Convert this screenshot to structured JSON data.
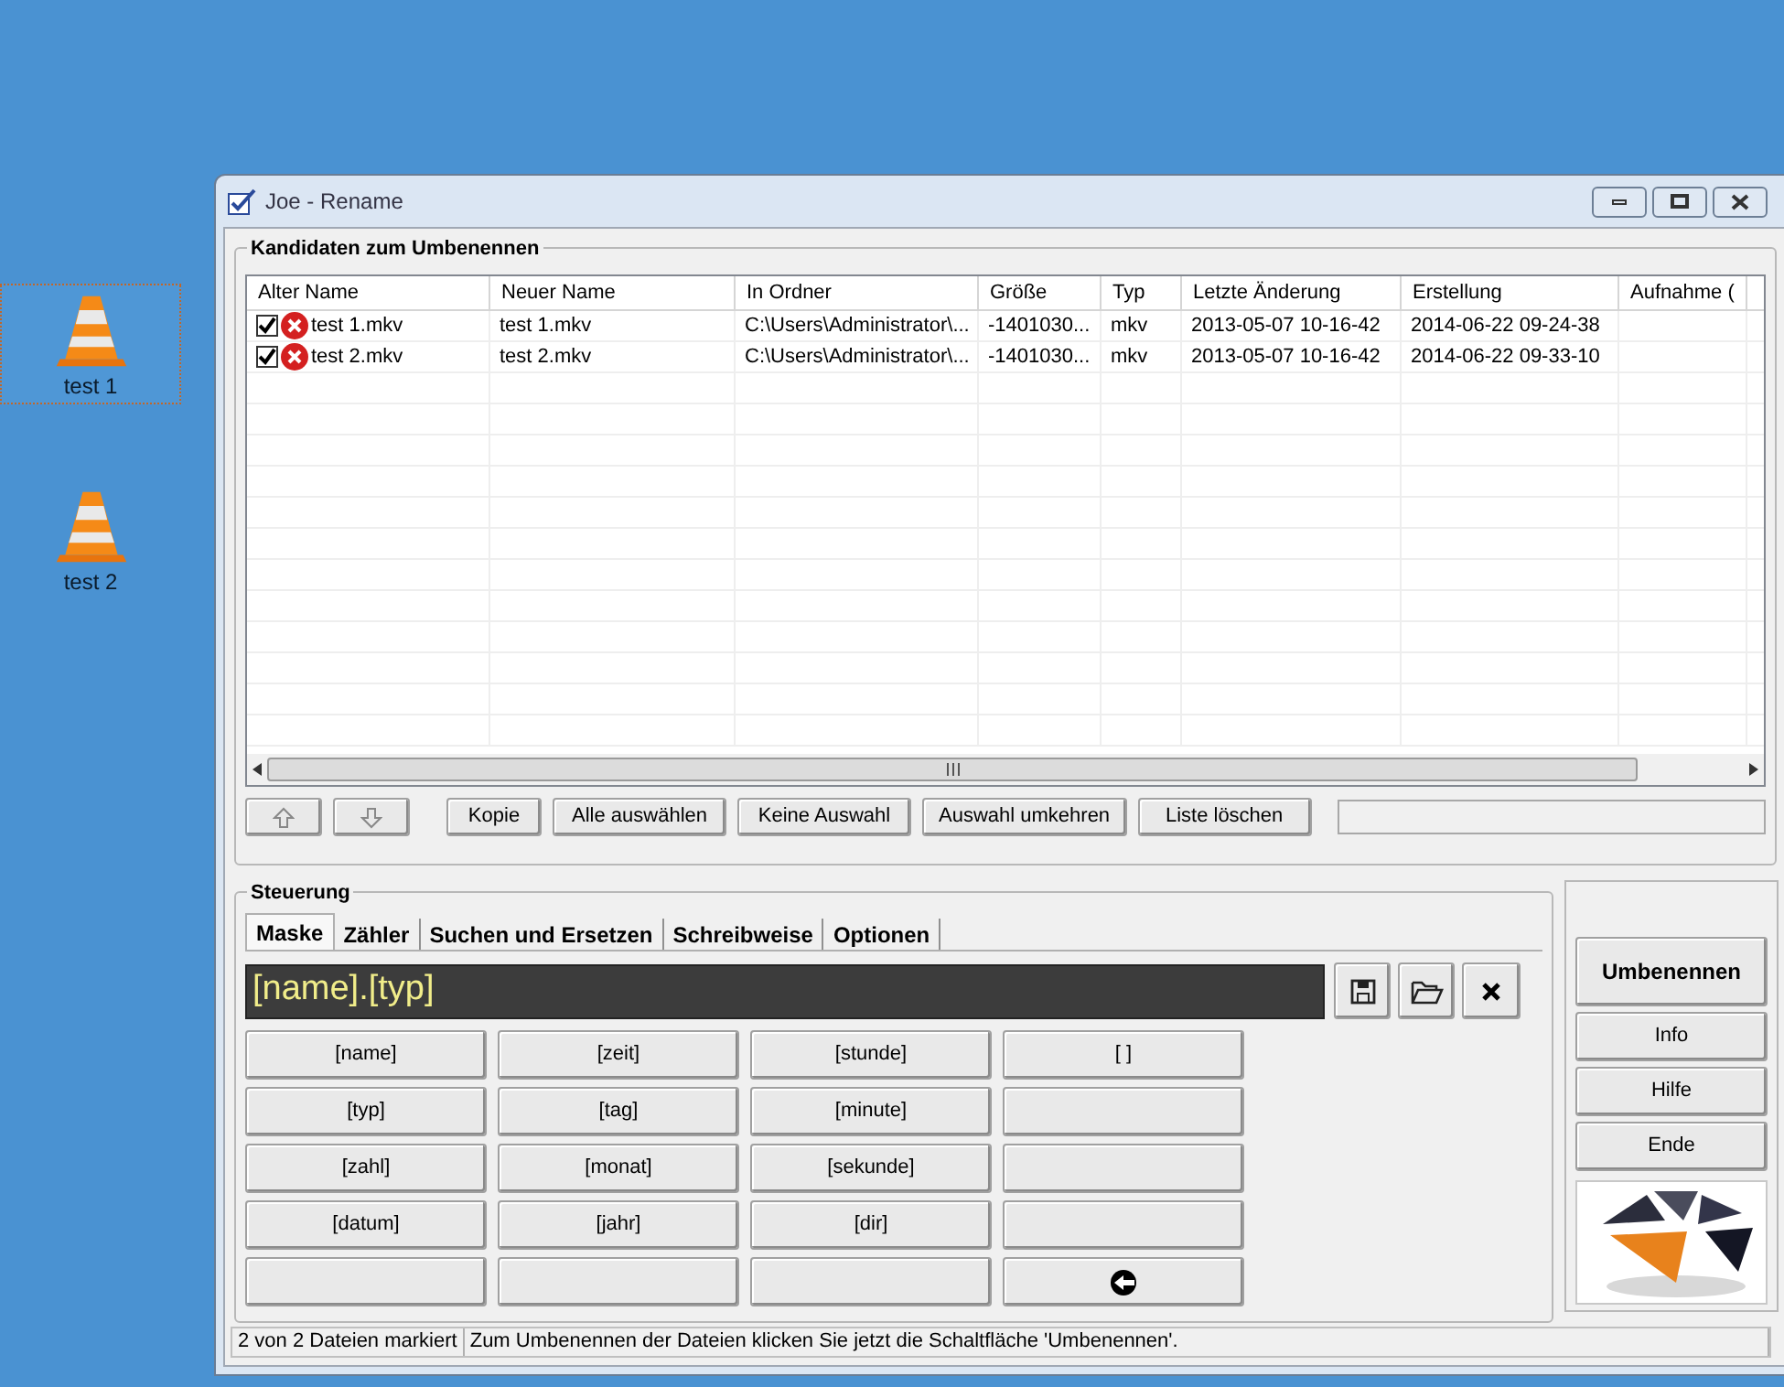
{
  "desktop_icons": [
    {
      "label": "test 1",
      "selected": true
    },
    {
      "label": "test 2",
      "selected": false
    }
  ],
  "window": {
    "title": "Joe - Rename"
  },
  "candidates": {
    "title": "Kandidaten zum Umbenennen",
    "columns": [
      "Alter Name",
      "Neuer Name",
      "In Ordner",
      "Größe",
      "Typ",
      "Letzte Änderung",
      "Erstellung",
      "Aufnahme ("
    ],
    "rows": [
      {
        "checked": true,
        "cells": [
          "test 1.mkv",
          "test 1.mkv",
          "C:\\Users\\Administrator\\...",
          "-1401030...",
          "mkv",
          "2013-05-07 10-16-42",
          "2014-06-22 09-24-38"
        ]
      },
      {
        "checked": true,
        "cells": [
          "test 2.mkv",
          "test 2.mkv",
          "C:\\Users\\Administrator\\...",
          "-1401030...",
          "mkv",
          "2013-05-07 10-16-42",
          "2014-06-22 09-33-10"
        ]
      }
    ],
    "buttons": [
      "Kopie",
      "Alle auswählen",
      "Keine Auswahl",
      "Auswahl umkehren",
      "Liste löschen"
    ]
  },
  "control": {
    "title": "Steuerung",
    "tabs": [
      {
        "label": "Maske",
        "selected": true
      },
      {
        "label": "Zähler",
        "selected": false
      },
      {
        "label": "Suchen und Ersetzen",
        "selected": false
      },
      {
        "label": "Schreibweise",
        "selected": false
      },
      {
        "label": "Optionen",
        "selected": false
      }
    ],
    "mask": {
      "value": "[name].[typ]"
    },
    "tokens": [
      {
        "kind": "text",
        "label": "[name]"
      },
      {
        "kind": "text",
        "label": "[zeit]"
      },
      {
        "kind": "text",
        "label": "[stunde]"
      },
      {
        "kind": "text",
        "label": "[ ]"
      },
      {
        "kind": "text",
        "label": "[typ]"
      },
      {
        "kind": "text",
        "label": "[tag]"
      },
      {
        "kind": "text",
        "label": "[minute]"
      },
      {
        "kind": "blank"
      },
      {
        "kind": "text",
        "label": "[zahl]"
      },
      {
        "kind": "text",
        "label": "[monat]"
      },
      {
        "kind": "text",
        "label": "[sekunde]"
      },
      {
        "kind": "blank"
      },
      {
        "kind": "text",
        "label": "[datum]"
      },
      {
        "kind": "text",
        "label": "[jahr]"
      },
      {
        "kind": "text",
        "label": "[dir]"
      },
      {
        "kind": "blank"
      },
      {
        "kind": "blank"
      },
      {
        "kind": "blank"
      },
      {
        "kind": "blank"
      },
      {
        "kind": "icon"
      }
    ],
    "side_buttons": [
      {
        "label": "Umbenennen",
        "kind": "primary"
      },
      {
        "label": "Info",
        "kind": "normal"
      },
      {
        "label": "Hilfe",
        "kind": "normal"
      },
      {
        "label": "Ende",
        "kind": "normal"
      }
    ]
  },
  "status_bar": [
    "2 von 2 Dateien markiert",
    "Zum Umbenennen der Dateien klicken Sie jetzt die Schaltfläche 'Umbenennen'."
  ]
}
